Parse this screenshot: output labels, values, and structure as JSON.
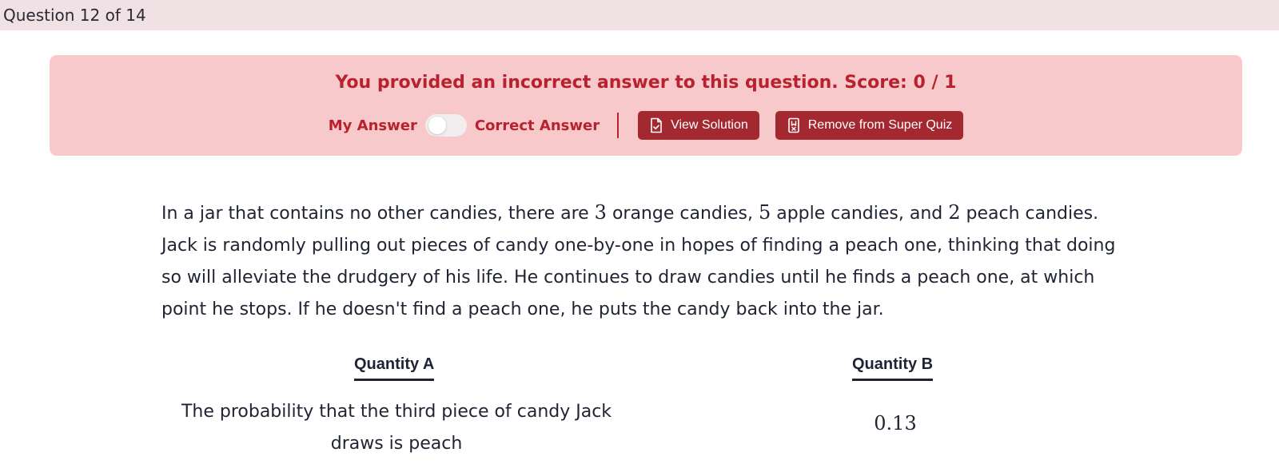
{
  "header": {
    "progress": "Question 12 of 14"
  },
  "banner": {
    "message": "You provided an incorrect answer to this question. Score: 0 / 1",
    "toggle_left_label": "My Answer",
    "toggle_right_label": "Correct Answer",
    "toggle_state": "my-answer",
    "view_solution_label": "View Solution",
    "remove_label": "Remove from Super Quiz",
    "accent_color": "#b8222f",
    "background_color": "#f8c9ca"
  },
  "question": {
    "part1": "In a jar that contains no other candies, there are ",
    "n1": "3",
    "part2": " orange candies, ",
    "n2": "5",
    "part3": " apple candies, and ",
    "n3": "2",
    "part4": " peach candies. Jack is randomly pulling out pieces of candy one-by-one in hopes of finding a peach one, thinking that doing so will alleviate the drudgery of his life. He continues to draw candies until he finds a peach one, at which point he stops. If he doesn't find a peach one, he puts the candy back into the jar."
  },
  "quantities": {
    "a_heading": "Quantity A",
    "a_text": "The probability that the third piece of candy Jack draws is peach",
    "b_heading": "Quantity B",
    "b_value": "0.13"
  },
  "icons": {
    "view_solution": "document-check-icon",
    "remove": "bookmark-x-icon"
  }
}
